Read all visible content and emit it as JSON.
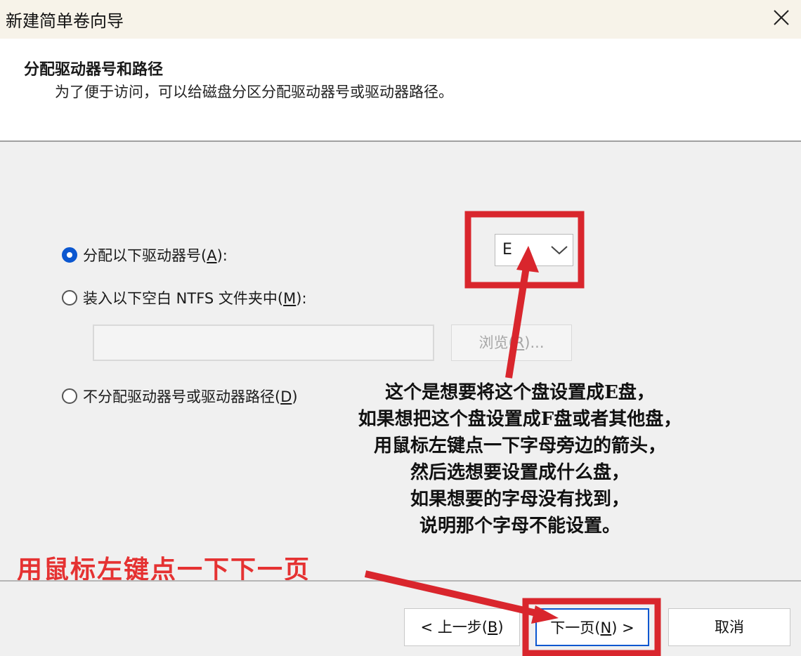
{
  "window": {
    "title": "新建简单卷向导"
  },
  "header": {
    "title": "分配驱动器号和路径",
    "subtitle": "为了便于访问，可以给磁盘分区分配驱动器号或驱动器路径。"
  },
  "options": {
    "assign_letter": {
      "label_pre": "分配以下驱动器号(",
      "key": "A",
      "label_post": "):",
      "selected": true
    },
    "mount_folder": {
      "label_pre": "装入以下空白 NTFS 文件夹中(",
      "key": "M",
      "label_post": "):",
      "selected": false
    },
    "no_assign": {
      "label_pre": "不分配驱动器号或驱动器路径(",
      "key": "D",
      "label_post": ")",
      "selected": false
    }
  },
  "drive_letter": {
    "value": "E"
  },
  "path_input": {
    "value": ""
  },
  "browse_button": {
    "label_pre": "浏览(",
    "key": "R",
    "label_post": ")..."
  },
  "buttons": {
    "back": {
      "label_pre": "< 上一步(",
      "key": "B",
      "label_post": ")"
    },
    "next": {
      "label_pre": "下一页(",
      "key": "N",
      "label_post": ") >"
    },
    "cancel": {
      "label": "取消"
    }
  },
  "annotations": {
    "tip_lines": [
      "这个是想要将这个盘设置成E盘，",
      "如果想把这个盘设置成F盘或者其他盘，",
      "用鼠标左键点一下字母旁边的箭头，",
      "然后选想要设置成什么盘，",
      "如果想要的字母没有找到，",
      "说明那个字母不能设置。"
    ],
    "next_tip": "用鼠标左键点一下下一页"
  },
  "colors": {
    "accent": "#0b57d0",
    "annotation_red": "#d9262d",
    "annotation_text_red": "#e53232"
  }
}
